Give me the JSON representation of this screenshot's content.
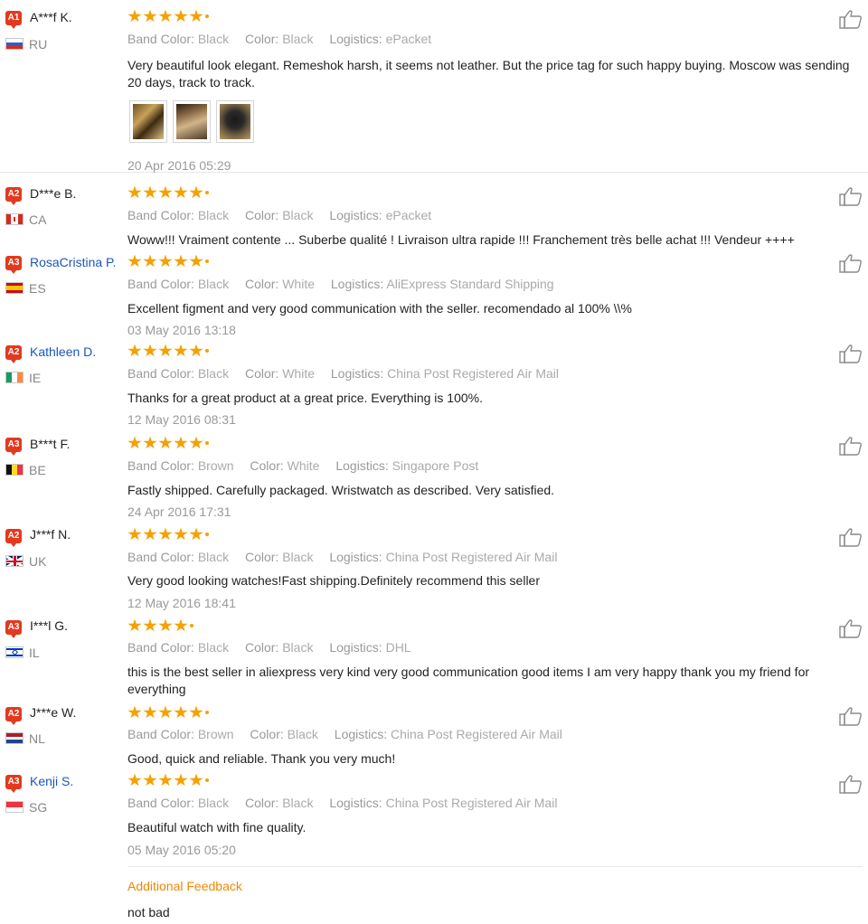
{
  "labels": {
    "band_color": "Band Color:",
    "color": "Color:",
    "logistics": "Logistics:"
  },
  "reviews": [
    {
      "rank": "A1",
      "name": "A***f K.",
      "country": "RU",
      "stars": 5,
      "band_color": "Black",
      "color": "Black",
      "logistics": "ePacket",
      "text": "Very beautiful look elegant. Remeshok harsh, it seems not leather. But the price tag for such happy buying. Moscow was sending 20 days, track to track.",
      "date": "20 Apr 2016 05:29"
    },
    {
      "rank": "A2",
      "name": "D***e B.",
      "country": "CA",
      "stars": 5,
      "band_color": "Black",
      "color": "Black",
      "logistics": "ePacket",
      "text": "Woww!!! Vraiment contente ... Suberbe qualité ! Livraison ultra rapide !!! Franchement très belle achat !!! Vendeur ++++",
      "date": ""
    },
    {
      "rank": "A3",
      "name": "RosaCristina P.",
      "country": "ES",
      "stars": 5,
      "band_color": "Black",
      "color": "White",
      "logistics": "AliExpress Standard Shipping",
      "text": "Excellent figment and very good communication with the seller. recomendado al 100% \\\\%",
      "date": "03 May 2016 13:18"
    },
    {
      "rank": "A2",
      "name": "Kathleen D.",
      "country": "IE",
      "stars": 5,
      "band_color": "Black",
      "color": "White",
      "logistics": "China Post Registered Air Mail",
      "text": "Thanks for a great product at a great price. Everything is 100%.",
      "date": "12 May 2016 08:31"
    },
    {
      "rank": "A3",
      "name": "B***t F.",
      "country": "BE",
      "stars": 5,
      "band_color": "Brown",
      "color": "White",
      "logistics": "Singapore Post",
      "text": "Fastly shipped. Carefully packaged. Wristwatch as described. Very satisfied.",
      "date": "24 Apr 2016 17:31"
    },
    {
      "rank": "A2",
      "name": "J***f N.",
      "country": "UK",
      "stars": 5,
      "band_color": "Black",
      "color": "Black",
      "logistics": "China Post Registered Air Mail",
      "text": "Very good looking watches!Fast shipping.Definitely recommend this seller",
      "date": "12 May 2016 18:41"
    },
    {
      "rank": "A3",
      "name": "I***l G.",
      "country": "IL",
      "stars": 4,
      "band_color": "Black",
      "color": "Black",
      "logistics": "DHL",
      "text": "this is the best seller in aliexpress very kind very good communication good items I am very happy thank you my friend for everything",
      "date": ""
    },
    {
      "rank": "A2",
      "name": "J***e W.",
      "country": "NL",
      "stars": 5,
      "band_color": "Brown",
      "color": "Black",
      "logistics": "China Post Registered Air Mail",
      "text": "Good, quick and reliable. Thank you very much!",
      "date": ""
    },
    {
      "rank": "A3",
      "name": "Kenji S.",
      "country": "SG",
      "stars": 5,
      "band_color": "Black",
      "color": "Black",
      "logistics": "China Post Registered Air Mail",
      "text": "Beautiful watch with fine quality.",
      "date": "05 May 2016 05:20"
    }
  ],
  "additional_feedback": {
    "title": "Additional Feedback",
    "text": "not bad"
  },
  "colors": {
    "star": "#f5a100",
    "rank_badge": "#e3391e",
    "accent_orange": "#f18700",
    "link_blue": "#1a56b8"
  }
}
